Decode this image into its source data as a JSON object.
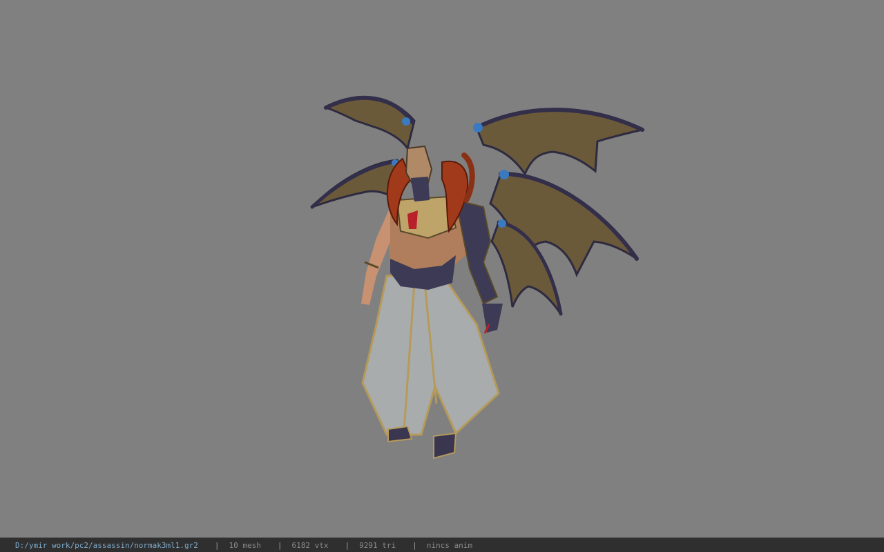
{
  "viewer": {
    "background_color": "#808080",
    "model_subject": "winged demon character model"
  },
  "status_bar": {
    "file_path": "D:/ymir work/pc2/assassin/normak3ml1.gr2",
    "separator": "|",
    "mesh_count": "10 mesh",
    "vertex_count": "6182 vtx",
    "triangle_count": "9291 tri",
    "animation": "nincs anim",
    "colors": {
      "background": "#2f2f2f",
      "path": "#7fa9c9",
      "text": "#8a8a8a"
    }
  }
}
